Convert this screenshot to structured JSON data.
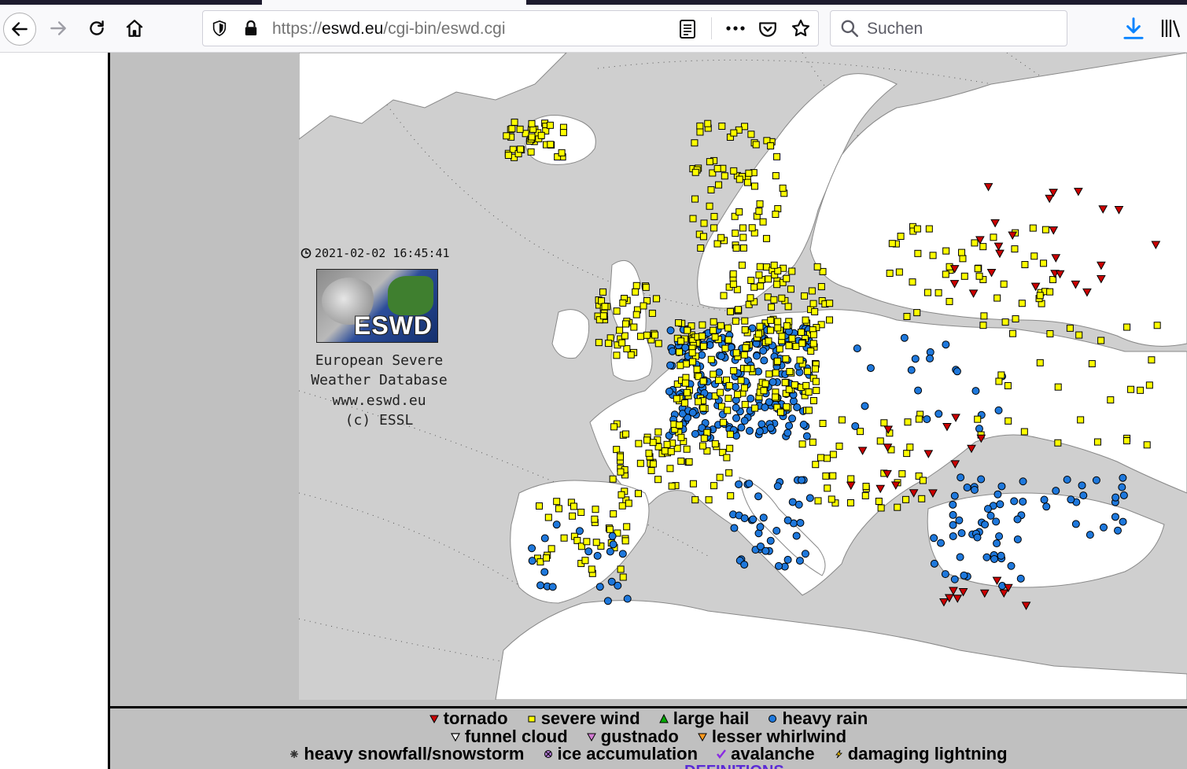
{
  "browser": {
    "url_scheme": "https://",
    "url_host": "eswd.eu",
    "url_path": "/cgi-bin/eswd.cgi",
    "search_placeholder": "Suchen",
    "icons": [
      "back-arrow-icon",
      "forward-arrow-icon",
      "reload-icon",
      "home-icon",
      "shield-icon",
      "lock-icon",
      "reader-view-icon",
      "more-actions-icon",
      "pocket-icon",
      "bookmark-star-icon",
      "search-icon",
      "download-icon",
      "library-icon"
    ]
  },
  "map": {
    "timestamp": "2021-02-02 16:45:41",
    "logo_text": "ESWD",
    "caption_line1": "European Severe",
    "caption_line2": "Weather Database",
    "caption_line3": "www.eswd.eu",
    "caption_line4": "(c) ESSL"
  },
  "legend": {
    "tornado": "tornado",
    "severe_wind": "severe wind",
    "large_hail": "large hail",
    "heavy_rain": "heavy rain",
    "funnel_cloud": "funnel cloud",
    "gustnado": "gustnado",
    "lesser_whirlwind": "lesser whirlwind",
    "heavy_snowfall": "heavy snowfall/snowstorm",
    "ice_accumulation": "ice accumulation",
    "avalanche": "avalanche",
    "damaging_lightning": "damaging lightning",
    "definitions": "DEFINITIONS"
  },
  "colors": {
    "tornado": "#cc0000",
    "severe_wind": "#ffff00",
    "large_hail": "#00aa00",
    "heavy_rain": "#1e78dc",
    "land": "#ffffff",
    "sea": "#cfcfcf",
    "frame": "#c0c0c0"
  }
}
